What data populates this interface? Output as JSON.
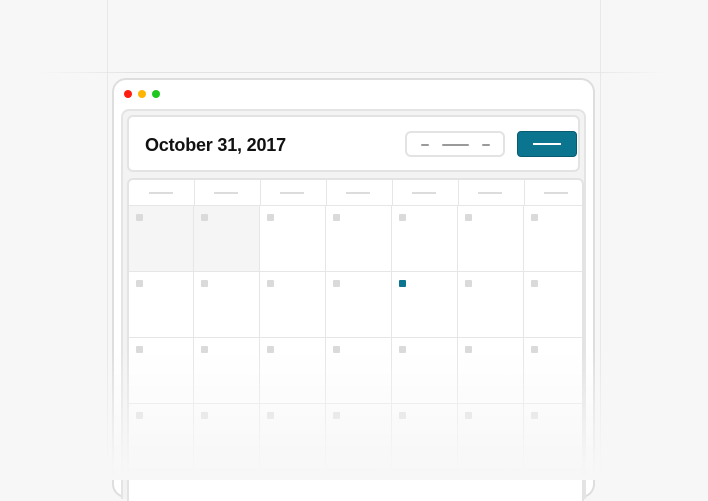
{
  "window": {
    "controls": [
      {
        "name": "close",
        "color": "#ff1e0f"
      },
      {
        "name": "minimize",
        "color": "#ffb400"
      },
      {
        "name": "maximize",
        "color": "#1ec81e"
      }
    ]
  },
  "header": {
    "date_title": "October 31, 2017",
    "view_switcher_icon": "segmented-control",
    "primary_action_icon": "dash",
    "accent_color": "#0b7590"
  },
  "calendar": {
    "weekdays": 7,
    "weeks": 4,
    "muted_cells": [
      [
        0,
        0
      ],
      [
        0,
        1
      ]
    ],
    "today_cell": [
      1,
      4
    ]
  }
}
